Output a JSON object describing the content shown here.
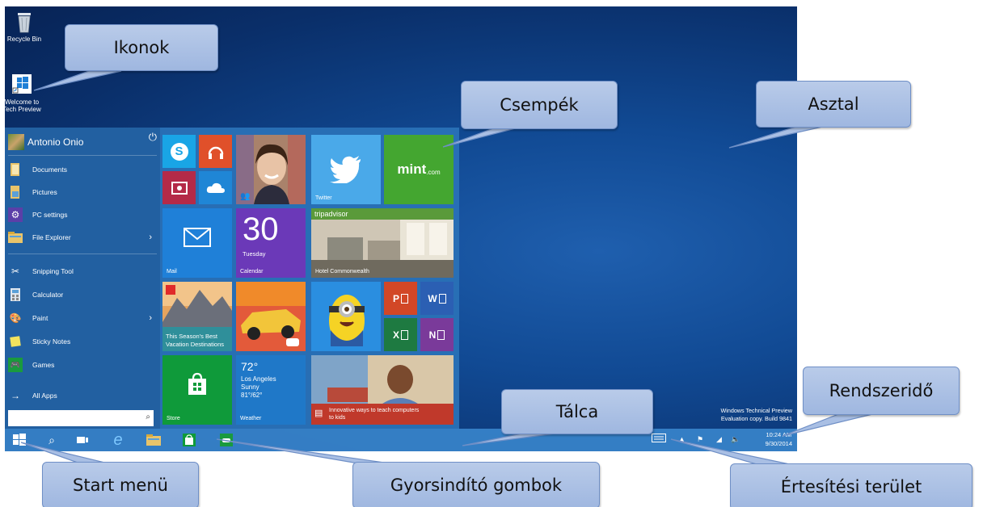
{
  "desktop": {
    "icons": [
      {
        "label": "Recycle Bin",
        "icon": "recycle-bin-icon"
      },
      {
        "label": "Welcome to Tech Preview",
        "icon": "windows-shortcut-icon"
      }
    ],
    "watermark_line1": "Windows Technical Preview",
    "watermark_line2": "Evaluation copy. Build 9841"
  },
  "start_menu": {
    "user_name": "Antonio Onio",
    "power_icon": "power-icon",
    "items": [
      {
        "label": "Documents",
        "icon": "documents-folder-icon"
      },
      {
        "label": "Pictures",
        "icon": "pictures-folder-icon"
      },
      {
        "label": "PC settings",
        "icon": "gear-icon"
      },
      {
        "label": "File Explorer",
        "icon": "file-explorer-icon"
      },
      {
        "label": "Snipping Tool",
        "icon": "snipping-tool-icon"
      },
      {
        "label": "Calculator",
        "icon": "calculator-icon"
      },
      {
        "label": "Paint",
        "icon": "paint-icon"
      },
      {
        "label": "Sticky Notes",
        "icon": "sticky-notes-icon"
      },
      {
        "label": "Games",
        "icon": "games-icon"
      }
    ],
    "all_apps": "All Apps",
    "tiles": {
      "twitter": "Twitter",
      "mint_logo": "mint",
      "mint_suffix": ".com",
      "mail": "Mail",
      "calendar_day": "30",
      "calendar_weekday": "Tuesday",
      "calendar": "Calendar",
      "tripadvisor_logo": "tripadvisor",
      "tripadvisor_caption": "Hotel Commonwealth",
      "flipboard_caption_1": "This Season's Best",
      "flipboard_caption_2": "Vacation Destinations",
      "store": "Store",
      "weather_temp": "72°",
      "weather_city": "Los Angeles",
      "weather_cond": "Sunny",
      "weather_range": "81°/62°",
      "weather": "Weather",
      "news_caption_1": "Innovative ways to teach computers",
      "news_caption_2": "to kids",
      "office_p": "P",
      "office_w": "W",
      "office_x": "X",
      "office_n": "N"
    }
  },
  "taskbar": {
    "clock_time": "10:24 AM",
    "clock_date": "9/30/2014"
  },
  "callouts": {
    "ikonok": "Ikonok",
    "csempek": "Csempék",
    "asztal": "Asztal",
    "rendszerido": "Rendszeridő",
    "talca": "Tálca",
    "start_menu": "Start menü",
    "gyorsindito": "Gyorsindító gombok",
    "ertesitesi": "Értesítési terület"
  },
  "colors": {
    "desktop": "#114a94",
    "start_menu": "#2a70b6",
    "taskbar": "#3782c8",
    "callout_fill": "#a9bfe4",
    "callout_border": "#6f8fc6"
  }
}
